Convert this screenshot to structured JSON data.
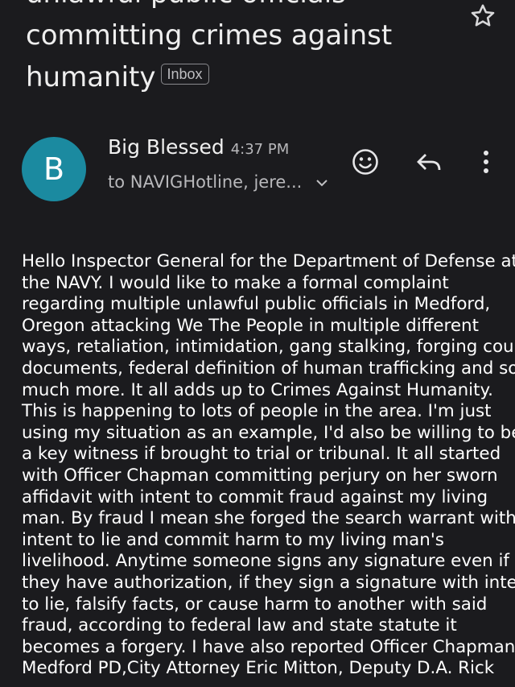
{
  "email": {
    "subject_lines": [
      "unlawful public officials",
      "committing crimes against",
      "humanity"
    ],
    "label_chip": "Inbox",
    "sender": {
      "avatar_letter": "B",
      "name": "Big Blessed",
      "time": "4:37 PM",
      "recipients": "to NAVIGHotline, jere..."
    },
    "icons": {
      "star": "star-outline-icon",
      "emoji": "emoji-reaction-icon",
      "reply": "reply-icon",
      "more": "more-vert-icon",
      "expand": "chevron-down-icon"
    },
    "body_lines": [
      "Hello Inspector General for the Department of Defense at",
      "the NAVY. I would like to make a formal complaint",
      "regarding multiple unlawful public officials in Medford,",
      "Oregon attacking We The People in multiple different",
      "ways, retaliation, intimidation, gang stalking, forging court",
      "documents, federal definition of human trafficking and so",
      "much more. It all adds up to Crimes Against Humanity.",
      "This is happening to lots of people in the area. I'm just",
      "using my situation as an example, I'd also be willing to be",
      "a key witness if brought to trial or tribunal. It all started",
      "with Officer Chapman committing perjury on her sworn",
      "affidavit with intent to commit fraud against my living",
      "man. By fraud I mean she forged the search warrant with",
      "intent to lie and commit harm to my living man's",
      "livelihood. Anytime someone signs any signature even if",
      "they have authorization, if they sign a signature with intent",
      "to lie, falsify facts, or cause harm to another with said",
      "fraud, according to federal law and state statute it",
      "becomes a forgery. I have also reported Officer Chapman",
      "Medford PD,City Attorney Eric Mitton, Deputy D.A. Rick"
    ]
  },
  "colors": {
    "background": "#1b1b1e",
    "avatar": "#1b8aa0",
    "text": "#ffffff",
    "secondary_text": "#b8b8bb"
  }
}
